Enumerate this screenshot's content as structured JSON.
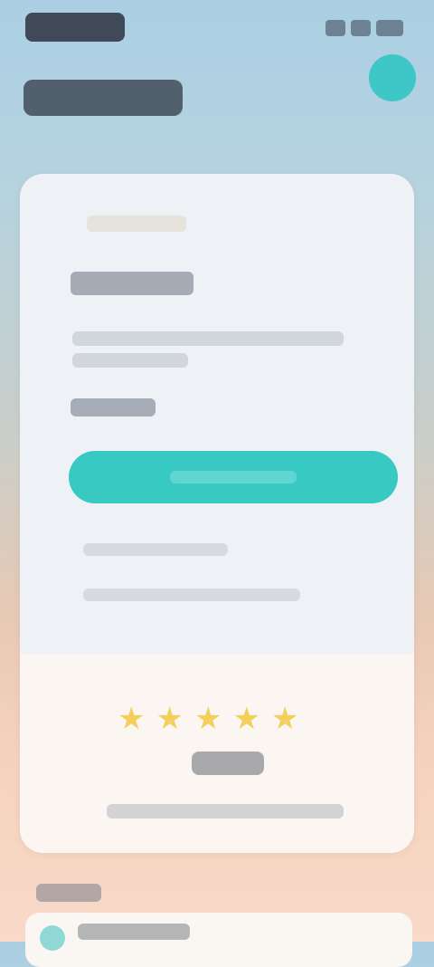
{
  "status_bar": {
    "time_label": "",
    "icons": [
      "signal-icon",
      "wifi-icon",
      "battery-icon"
    ]
  },
  "header": {
    "title": "",
    "profile_button_label": ""
  },
  "card": {
    "kicker": "",
    "title": "",
    "description": "",
    "field_label": "",
    "primary_button_label": "",
    "links": [
      "",
      ""
    ],
    "rating": {
      "stars_filled": 5,
      "stars_total": 5,
      "value_label": "",
      "caption": ""
    }
  },
  "section": {
    "label": "",
    "first_item_label": ""
  },
  "colors": {
    "accent": "#39c9c3",
    "star": "#f3cf5c"
  }
}
